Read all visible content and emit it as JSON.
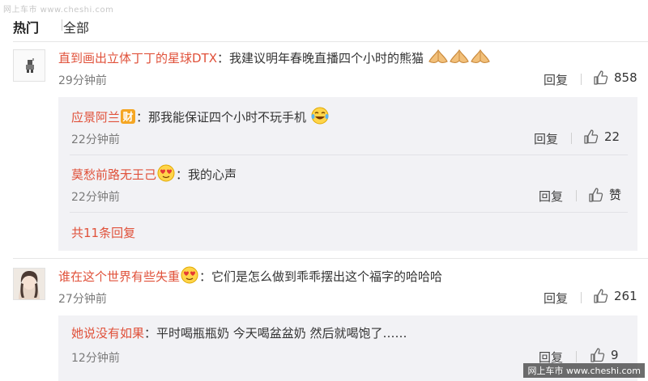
{
  "watermark_top": "网上车市 www.cheshi.com",
  "watermark_bottom": "网上车市 www.cheshi.com",
  "tabs": [
    {
      "label": "热门",
      "active": true
    },
    {
      "label": "全部",
      "active": false
    }
  ],
  "reply_label": "回复",
  "comments": [
    {
      "user": "直到画出立体丁丁的星球DTX",
      "text": "：我建议明年春晚直播四个小时的熊猫",
      "emojis": [
        "praying-hands-icon",
        "praying-hands-icon",
        "praying-hands-icon"
      ],
      "time": "29分钟前",
      "likes": "858",
      "replies": [
        {
          "user": "应景阿兰",
          "badge": "财",
          "text": "：那我能保证四个小时不玩手机",
          "emoji": "laughing-tears-emoji-icon",
          "time": "22分钟前",
          "likes": "22"
        },
        {
          "user": "莫愁前路无王己",
          "badge": "love-emoji-icon",
          "text": "：我的心声",
          "time": "22分钟前",
          "likes": "赞"
        }
      ],
      "more_replies": "共11条回复"
    },
    {
      "user": "谁在这个世界有些失重",
      "text": "：它们是怎么做到乖乖摆出这个福字的哈哈哈",
      "time": "27分钟前",
      "likes": "261",
      "replies": [
        {
          "user": "她说没有如果",
          "text": "：平时喝瓶瓶奶 今天喝盆盆奶 然后就喝饱了……",
          "time": "12分钟前",
          "likes": "9"
        }
      ]
    }
  ],
  "colors": {
    "username": "#e0513a",
    "nested_bg": "#f2f2f5",
    "badge": "#f5a623"
  }
}
